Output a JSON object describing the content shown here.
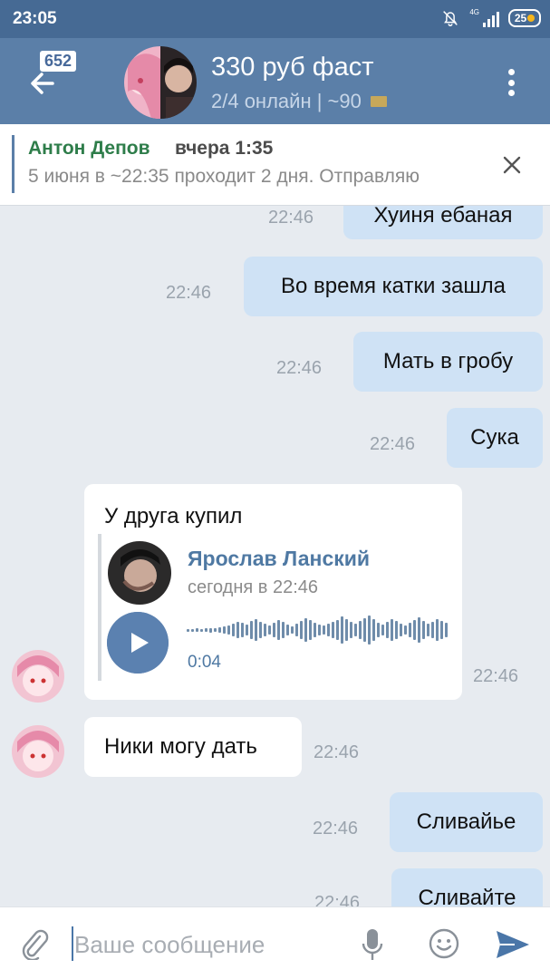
{
  "status_bar": {
    "time": "23:05",
    "network": "4G",
    "battery": "25"
  },
  "header": {
    "badge": "652",
    "title": "330 руб фаст",
    "subtitle": "2/4 онлайн | ~90"
  },
  "pinned": {
    "author": "Антон Депов",
    "time": "вчера 1:35",
    "text": "5 июня в ~22:35 проходит 2 дня. Отправляю"
  },
  "messages": [
    {
      "text": "Хуиня ебаная",
      "time": "22:46"
    },
    {
      "text": "Во время катки зашла",
      "time": "22:46"
    },
    {
      "text": "Мать в гробу",
      "time": "22:46"
    },
    {
      "text": "Сука",
      "time": "22:46"
    },
    {
      "text": "У друга купил",
      "time": "22:46",
      "forward": {
        "author": "Ярослав Ланский",
        "time": "сегодня в 22:46",
        "duration": "0:04"
      }
    },
    {
      "text": "Ники могу дать",
      "time": "22:46"
    },
    {
      "text": "Сливайье",
      "time": "22:46"
    },
    {
      "text": "Сливайте",
      "time": "22:46"
    }
  ],
  "input": {
    "placeholder": "Ваше сообщение"
  },
  "icons": [
    "back-arrow-icon",
    "more-vert-icon",
    "close-icon",
    "play-icon",
    "attach-icon",
    "microphone-icon",
    "emoji-icon",
    "send-icon",
    "mute-bell-icon"
  ],
  "colors": {
    "header": "#5b7fa8",
    "status_bar": "#466a94",
    "outgoing_bubble": "#cfe2f5",
    "background": "#e7ebf0",
    "accent": "#4f79a3"
  }
}
